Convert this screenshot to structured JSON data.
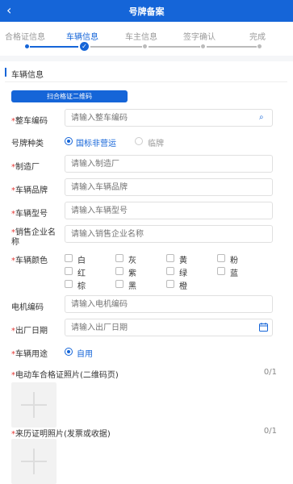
{
  "header": {
    "title": "号牌备案",
    "back_icon": "chevron-left-icon"
  },
  "steps": [
    {
      "label": "合格证信息",
      "state": "done"
    },
    {
      "label": "车辆信息",
      "state": "current"
    },
    {
      "label": "车主信息",
      "state": "todo"
    },
    {
      "label": "签字确认",
      "state": "todo"
    },
    {
      "label": "完成",
      "state": "todo"
    }
  ],
  "section": {
    "title": "车辆信息"
  },
  "scan_button": "扫合格证二维码",
  "form": {
    "vin": {
      "label": "整车编码",
      "placeholder": "请输入整车编码",
      "required": true
    },
    "plate_type": {
      "label": "号牌种类",
      "options": [
        "国标非营运",
        "临牌"
      ],
      "selected": "国标非营运"
    },
    "manufacturer": {
      "label": "制造厂",
      "placeholder": "请输入制造厂",
      "required": true
    },
    "brand": {
      "label": "车辆品牌",
      "placeholder": "请输入车辆品牌",
      "required": true
    },
    "model": {
      "label": "车辆型号",
      "placeholder": "请输入车辆型号",
      "required": true
    },
    "dealer": {
      "label_line1": "销售企业名",
      "label_line2": "称",
      "placeholder": "请输入销售企业名称",
      "required": true
    },
    "color": {
      "label": "车辆颜色",
      "required": true,
      "options": [
        "白",
        "灰",
        "黄",
        "粉",
        "红",
        "紫",
        "绿",
        "蓝",
        "棕",
        "黑",
        "橙"
      ]
    },
    "motor": {
      "label": "电机编码",
      "placeholder": "请输入电机编码",
      "required": false
    },
    "factory_date": {
      "label": "出厂日期",
      "placeholder": "请输入出厂日期",
      "required": true
    },
    "usage": {
      "label": "车辆用途",
      "selected": "自用",
      "required": true
    }
  },
  "uploads": [
    {
      "title": "电动车合格证照片(二维码页)",
      "count": "0/1",
      "required": true
    },
    {
      "title": "来历证明照片(发票或收据)",
      "count": "0/1",
      "required": true
    }
  ],
  "colors": {
    "primary": "#1565d8",
    "required": "#e53935"
  }
}
